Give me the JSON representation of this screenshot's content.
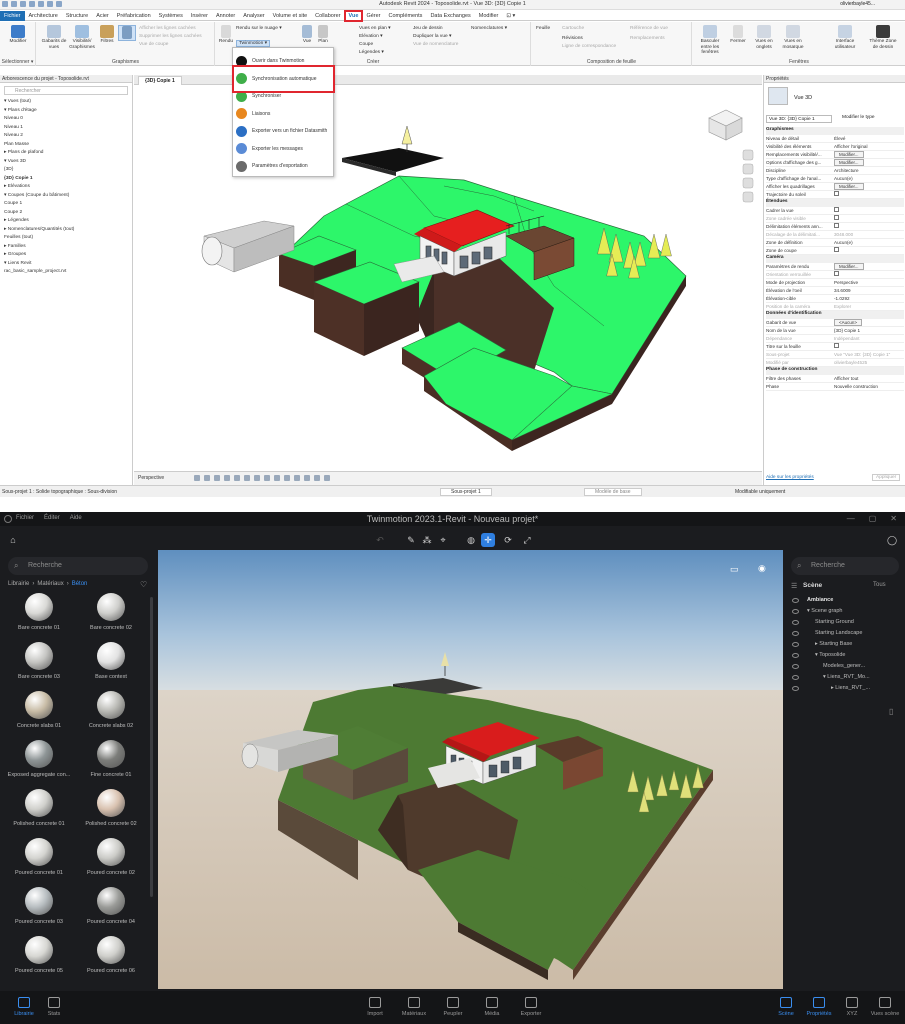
{
  "revit": {
    "title": "Autodesk Revit 2024 - Toposolide.rvt - Vue 3D: {3D} Copie 1",
    "user": "olivierbayle45...",
    "tabs": [
      "Fichier",
      "Architecture",
      "Structure",
      "Acier",
      "Préfabrication",
      "Systèmes",
      "Insérer",
      "Annoter",
      "Analyser",
      "Volume et site",
      "Collaborer",
      "Vue",
      "Gérer",
      "Compléments",
      "Data Exchanges",
      "Modifier",
      "⊡ ▾"
    ],
    "active_tab": "Vue",
    "ribbon": {
      "modifier": "Modifier",
      "selectionner": "Sélectionner ▾",
      "gabarits": "Gabarits de vues",
      "visibilite": "Visibilité/ Graphismes",
      "filtres": "Filtres",
      "lignes_fines": "Lignes fines",
      "graph_small": [
        "Afficher les lignes cachées",
        "Supprimer les lignes cachées",
        "Vue de coupe"
      ],
      "graphismes_label": "Graphismes",
      "rendu": "Rendu",
      "rendu_nuage": "Rendu sur le nuage ▾",
      "twinmotion": "Twinmotion ▾",
      "vue": "Vue",
      "plan": "Plan",
      "creer_small": [
        "Vues en plan ▾",
        "Elévation ▾",
        "Coupe",
        "Légendes ▾"
      ],
      "creer_small2": [
        "Jeu de dessin",
        "Dupliquer la vue ▾",
        "Vue de nomenclature"
      ],
      "nomenclatures": "Nomenclatures ▾",
      "creer_label": "Créer",
      "feuille": "Feuille",
      "revisions": "Révisions",
      "feuille_small": [
        "Cartouche",
        "Ligne de correspondance",
        "Référence de vue",
        "Remplacements"
      ],
      "composition_label": "Composition de feuille",
      "basculer": "Basculer entre les fenêtres",
      "fermer": "Fermer",
      "vues_onglets": "Vues en onglets",
      "vues_mosaique": "Vues en mosaïque",
      "interface": "Interface utilisateur",
      "theme": "Thème Zone de dessin",
      "fenetres_label": "Fenêtres"
    },
    "menu": [
      {
        "label": "Ouvrir dans Twinmotion",
        "icon": "twinmotion-icon"
      },
      {
        "label": "Synchronisation automatique",
        "icon": "auto-sync-icon"
      },
      {
        "label": "Synchroniser",
        "icon": "sync-icon"
      },
      {
        "label": "Liaisons",
        "icon": "link-icon"
      },
      {
        "label": "Exporter vers un fichier Datasmith",
        "icon": "datasmith-icon"
      },
      {
        "label": "Exporter les messages",
        "icon": "messages-icon"
      },
      {
        "label": "Paramètres d'exportation",
        "icon": "settings-icon"
      }
    ],
    "project_browser": {
      "title": "Arborescence du projet - Toposolide.rvt",
      "search": "Rechercher",
      "tree": [
        "▾  Vues (tout)",
        "   ▾  Plans d'étage",
        "         Niveau 0",
        "         Niveau 1",
        "         Niveau 2",
        "         Plan Masse",
        "   ▸  Plans de plafond",
        "   ▾  Vues 3D",
        "         {3D}",
        "         {3D} Copie 1",
        "   ▸  Elévations",
        "   ▾  Coupes (Coupe du bâtiment)",
        "         Coupe 1",
        "         Coupe 2",
        "▸  Légendes",
        "▸  Nomenclatures/Quantités (tout)",
        "   Feuilles (tout)",
        "▸  Familles",
        "▸  Groupes",
        "▾  Liens Revit",
        "      rac_basic_sample_project.rvt"
      ]
    },
    "view_tab": "{3D} Copie 1",
    "view_bar": "Perspective",
    "properties": {
      "title": "Propriétés",
      "type": "Vue 3D",
      "selector": "Vue 3D: {3D} Copie 1",
      "modify_type": "Modifier le type",
      "sections": [
        {
          "name": "Graphismes",
          "rows": [
            [
              "Niveau de détail",
              "Élevé"
            ],
            [
              "Visibilité des éléments",
              "Afficher l'original"
            ],
            [
              "Remplacements visibilité/...",
              "Modifier..."
            ],
            [
              "Options d'affichage des g...",
              "Modifier..."
            ],
            [
              "Discipline",
              "Architecture"
            ],
            [
              "Type d'affichage de l'anal...",
              "Aucun(e)"
            ],
            [
              "Afficher les quadrillages",
              "Modifier..."
            ],
            [
              "Trajectoire du soleil",
              ""
            ]
          ]
        },
        {
          "name": "Étendues",
          "rows": [
            [
              "Cadrer la vue",
              ""
            ],
            [
              "Zone cadrée visible",
              ""
            ],
            [
              "Délimitation éléments ann...",
              ""
            ],
            [
              "Décalage de la délimitati...",
              "3048.000"
            ],
            [
              "Zone de définition",
              "Aucun(e)"
            ],
            [
              "Zone de coupe",
              ""
            ]
          ]
        },
        {
          "name": "Caméra",
          "rows": [
            [
              "Paramètres de rendu",
              "Modifier..."
            ],
            [
              "Orientation verrouillée",
              ""
            ],
            [
              "Mode de projection",
              "Perspective"
            ],
            [
              "Élévation de l'oeil",
              "34.6009"
            ],
            [
              "Élévation-cible",
              "-1.0292"
            ],
            [
              "Position de la caméra",
              "Explorer"
            ]
          ]
        },
        {
          "name": "Données d'identification",
          "rows": [
            [
              "Gabarit de vue",
              "<Aucun>"
            ],
            [
              "Nom de la vue",
              "{3D} Copie 1"
            ],
            [
              "Dépendance",
              "Indépendant"
            ],
            [
              "Titre sur la feuille",
              ""
            ],
            [
              "Sous-projet",
              "Vue \"Vue 3D: {3D} Copie 1\""
            ],
            [
              "Modifié par",
              "olivierbayle4525"
            ]
          ]
        },
        {
          "name": "Phase de construction",
          "rows": [
            [
              "Filtre des phases",
              "Afficher tout"
            ],
            [
              "Phase",
              "Nouvelle construction"
            ]
          ]
        }
      ],
      "help": "Aide sur les propriétés",
      "apply": "Appliquer"
    },
    "status_left": "Sous-projet 1 : Solide topographique : Sous-division",
    "status_subproject": "Sous-projet 1",
    "status_model": "Modèle de base",
    "status_editable": "Modifiable uniquement"
  },
  "twinmotion": {
    "menus": [
      "Fichier",
      "Éditer",
      "Aide"
    ],
    "title": "Twinmotion 2023.1-Revit - Nouveau projet*",
    "library_search": "Recherche",
    "breadcrumb": [
      "Librairie",
      "Matériaux",
      "Béton"
    ],
    "materials": [
      {
        "name": "Bare concrete 01",
        "color": "#d9d9d6"
      },
      {
        "name": "Bare concrete 02",
        "color": "#cfcfcc"
      },
      {
        "name": "Bare concrete 03",
        "color": "#c5c5c2"
      },
      {
        "name": "Base context",
        "color": "#e2e2e2"
      },
      {
        "name": "Concrete slabs 01",
        "color": "#c8bca6"
      },
      {
        "name": "Concrete slabs 02",
        "color": "#b9b9b4"
      },
      {
        "name": "Exposed aggregate con...",
        "color": "#8e9596"
      },
      {
        "name": "Fine concrete 01",
        "color": "#7c7d7a"
      },
      {
        "name": "Polished concrete 01",
        "color": "#d0d0cc"
      },
      {
        "name": "Polished concrete 02",
        "color": "#d9c2b0"
      },
      {
        "name": "Poured concrete 01",
        "color": "#d4d4d0"
      },
      {
        "name": "Poured concrete 02",
        "color": "#cbcbc7"
      },
      {
        "name": "Poured concrete 03",
        "color": "#b7bdc0"
      },
      {
        "name": "Poured concrete 04",
        "color": "#9a9b98"
      },
      {
        "name": "Poured concrete 05",
        "color": "#d7d7d3"
      },
      {
        "name": "Poured concrete 06",
        "color": "#cfcfcb"
      }
    ],
    "scene_search": "Recherche",
    "scene_title": "Scène",
    "scene_filter": "Tous",
    "scene_tree": [
      {
        "label": "Ambiance",
        "indent": 0,
        "bold": true
      },
      {
        "label": "▾ Scene graph",
        "indent": 0,
        "bold": false
      },
      {
        "label": "Starting Ground",
        "indent": 1,
        "bold": false
      },
      {
        "label": "Starting Landscape",
        "indent": 1,
        "bold": false
      },
      {
        "label": "▸ Starting Base",
        "indent": 1,
        "bold": false
      },
      {
        "label": "▾ Toposolide",
        "indent": 1,
        "bold": false
      },
      {
        "label": "Modeles_gener...",
        "indent": 2,
        "bold": false
      },
      {
        "label": "▾ Liens_RVT_Mo...",
        "indent": 2,
        "bold": false
      },
      {
        "label": "▸ Liens_RVT_...",
        "indent": 3,
        "bold": false
      }
    ],
    "bottom_left": [
      {
        "label": "Librairie",
        "active": true
      },
      {
        "label": "Stats",
        "active": false
      }
    ],
    "bottom_center": [
      "Import",
      "Matériaux",
      "Peupler",
      "Média",
      "Exporter"
    ],
    "bottom_right": [
      {
        "label": "Scène",
        "active": true
      },
      {
        "label": "Propriétés",
        "active": true
      },
      {
        "label": "XYZ",
        "active": false
      },
      {
        "label": "Vues scène",
        "active": false
      }
    ]
  }
}
